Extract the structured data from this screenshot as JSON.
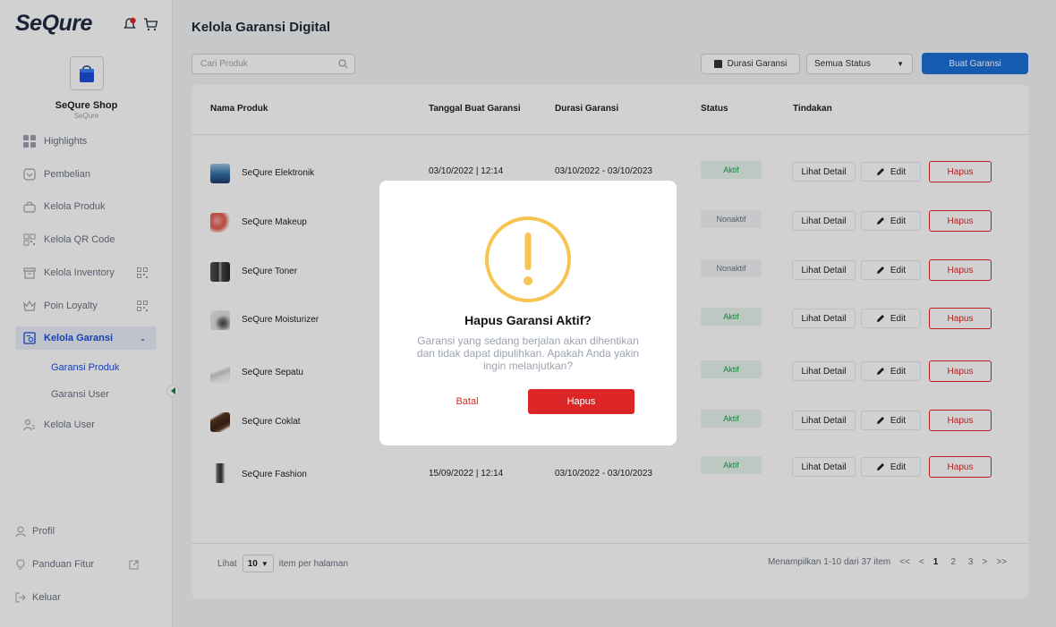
{
  "app": {
    "logo": "SeQure",
    "notification_count": ""
  },
  "sidebar": {
    "shop_name": "SeQure Shop",
    "shop_sub": "SeQure",
    "items": [
      {
        "label": "Highlights"
      },
      {
        "label": "Pembelian"
      },
      {
        "label": "Kelola Produk"
      },
      {
        "label": "Kelola QR Code"
      },
      {
        "label": "Kelola Inventory"
      },
      {
        "label": "Poin Loyalty"
      },
      {
        "label": "Kelola Garansi"
      }
    ],
    "sub_items": [
      {
        "label": "Garansi Produk"
      },
      {
        "label": "Garansi User"
      }
    ],
    "user_item": "Kelola User",
    "bottom": {
      "profil": "Profil",
      "panduan": "Panduan Fitur",
      "keluar": "Keluar"
    }
  },
  "header": {
    "title": "Kelola Garansi Digital",
    "search_placeholder": "Cari Produk",
    "durasi_label": "Durasi Garansi",
    "status_select": "Semua Status",
    "create_label": "Buat Garansi"
  },
  "table": {
    "columns": [
      "Nama Produk",
      "Tanggal Buat Garansi",
      "Durasi Garansi",
      "Status",
      "Tindakan"
    ],
    "action_detail": "Lihat Detail",
    "action_edit": "Edit",
    "action_delete": "Hapus",
    "rows": [
      {
        "name": "SeQure Elektronik",
        "date": "03/10/2022 | 12:14",
        "duration": "03/10/2022 - 03/10/2023",
        "status": "Aktif"
      },
      {
        "name": "SeQure Makeup",
        "date": "",
        "duration": "",
        "status": "Nonaktif"
      },
      {
        "name": "SeQure Toner",
        "date": "",
        "duration": "",
        "status": "Nonaktif"
      },
      {
        "name": "SeQure Moisturizer",
        "date": "",
        "duration": "",
        "status": "Aktif"
      },
      {
        "name": "SeQure Sepatu",
        "date": "",
        "duration": "",
        "status": "Aktif"
      },
      {
        "name": "SeQure Coklat",
        "date": "",
        "duration": "",
        "status": "Aktif"
      },
      {
        "name": "SeQure Fashion",
        "date": "15/09/2022 | 12:14",
        "duration": "03/10/2022 - 03/10/2023",
        "status": "Aktif"
      }
    ]
  },
  "pagination": {
    "lihat": "Lihat",
    "per_page": "10",
    "per_page_suffix": "item per halaman",
    "summary": "Menampilkan 1-10 dari 37 item",
    "first": "<<",
    "prev": "<",
    "pages": [
      "1",
      "2",
      "3"
    ],
    "next": ">",
    "last": ">>"
  },
  "modal": {
    "title": "Hapus Garansi Aktif?",
    "body": "Garansi yang sedang berjalan akan dihentikan dan tidak dapat dipulihkan. Apakah Anda yakin ingin melanjutkan?",
    "cancel": "Batal",
    "confirm": "Hapus"
  },
  "colors": {
    "primary": "#1d6fd8",
    "danger": "#dc2626",
    "success": "#16a34a",
    "warning": "#f6c453"
  }
}
